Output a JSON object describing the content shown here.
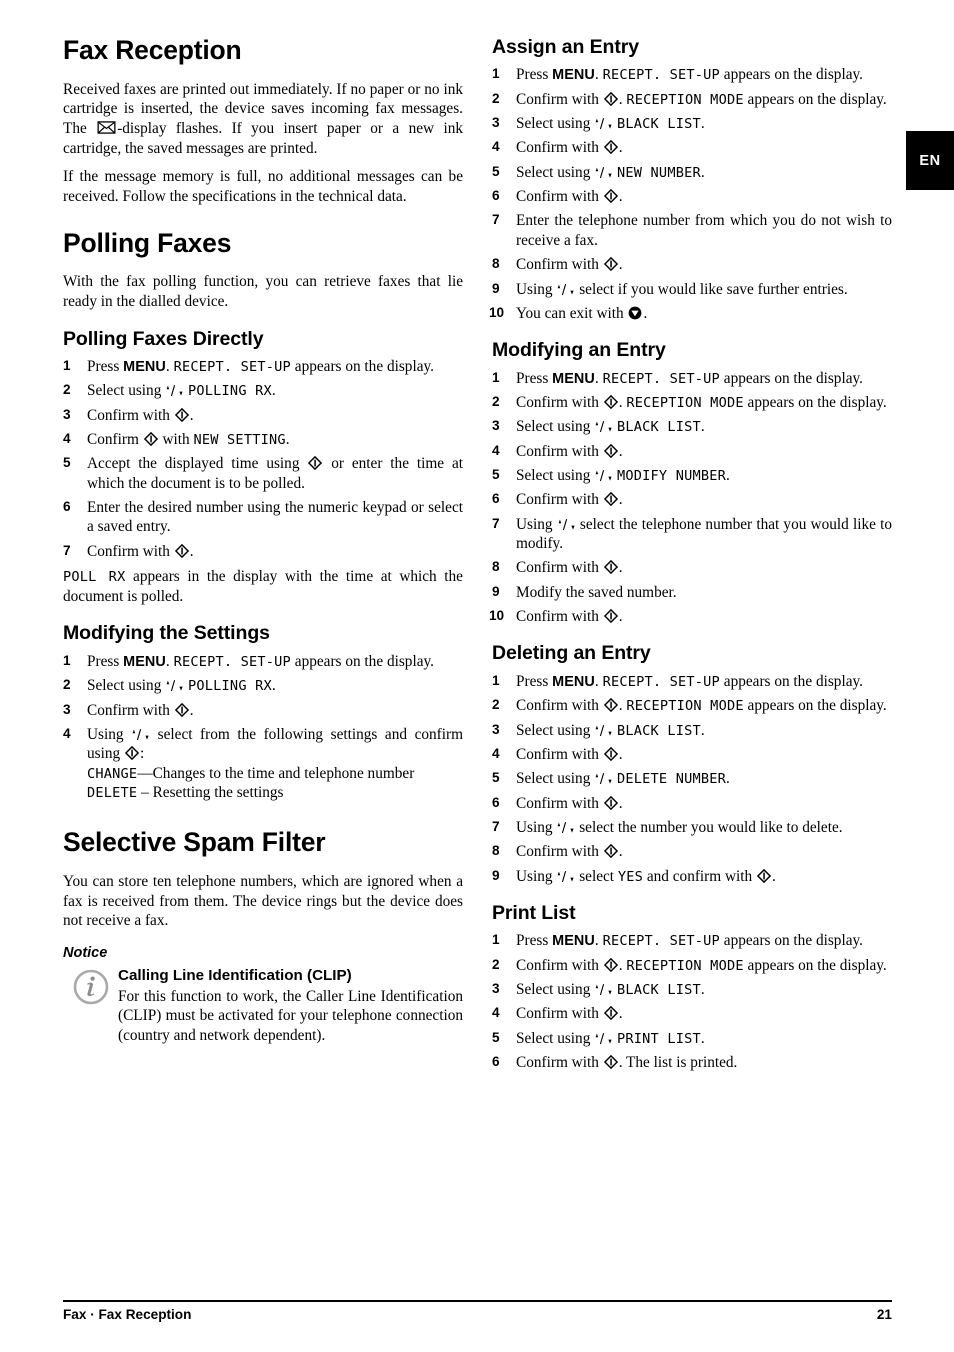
{
  "language_tab": "EN",
  "left_column": {
    "h1_fax_reception": "Fax Reception",
    "p_intro_1a": "Received faxes are printed out immediately. If no paper or no ink cartridge is inserted, the device saves incoming fax messages. The ",
    "p_intro_1b": "-display flashes. If you insert paper or a new ink cartridge, the saved messages are printed.",
    "p_intro_2": "If the message memory is full, no additional messages can be received. Follow the specifications in the technical data.",
    "h1_polling_faxes": "Polling Faxes",
    "p_polling_intro": "With the fax polling function, you can retrieve faxes that lie ready in the dialled device.",
    "h2_polling_directly": "Polling Faxes Directly",
    "polling_directly_steps": [
      {
        "num": "1",
        "pre": "Press ",
        "key": "MENU",
        "mid": ". ",
        "lcd": "RECEPT. SET-UP",
        "post": " appears on the display."
      },
      {
        "num": "2",
        "pre": "Select using ",
        "icon": "updown",
        "mid": " ",
        "lcd": "POLLING RX",
        "post": "."
      },
      {
        "num": "3",
        "pre": "Confirm with ",
        "icon": "ok",
        "post": "."
      },
      {
        "num": "4",
        "pre": "Confirm ",
        "lcd": "NEW SETTING",
        "mid": " with ",
        "icon": "ok",
        "post": "."
      },
      {
        "num": "5",
        "pre": "Accept the displayed time using ",
        "icon": "ok",
        "post": " or enter the time at which the document is to be polled."
      },
      {
        "num": "6",
        "pre": "Enter the desired number using the numeric keypad or select a saved entry."
      },
      {
        "num": "7",
        "pre": "Confirm with ",
        "icon": "ok",
        "post": "."
      }
    ],
    "p_poll_rx_lcd": "POLL RX",
    "p_poll_rx_text": " appears in the display with the time at which the document is polled.",
    "h2_modifying_settings": "Modifying the Settings",
    "modifying_settings_steps": [
      {
        "num": "1",
        "pre": "Press ",
        "key": "MENU",
        "mid": ". ",
        "lcd": "RECEPT. SET-UP",
        "post": " appears on the display."
      },
      {
        "num": "2",
        "pre": "Select using ",
        "icon": "updown",
        "mid": " ",
        "lcd": "POLLING RX",
        "post": "."
      },
      {
        "num": "3",
        "pre": "Confirm with ",
        "icon": "ok",
        "post": "."
      }
    ],
    "step4_pre": "Using ",
    "step4_mid": " select from the following settings and confirm using ",
    "step4_colon": ":",
    "step4_change_lcd": "CHANGE",
    "step4_change_text": "—Changes to the time and telephone number",
    "step4_delete_lcd": "DELETE",
    "step4_delete_text": " – Resetting the settings",
    "h1_spam_filter": "Selective Spam Filter",
    "p_spam_intro": "You can store ten telephone numbers, which are ignored when a fax is received from them. The device rings but the device does not receive a fax.",
    "h3_notice": "Notice",
    "notice_title": "Calling Line Identification (CLIP)",
    "notice_text": "For this function to work, the Caller Line Identification (CLIP) must be activated for your telephone connection (country and network dependent)."
  },
  "right_column": {
    "h2_assign_entry": "Assign an Entry",
    "assign_entry_steps": [
      {
        "num": "1",
        "pre": "Press ",
        "key": "MENU",
        "mid": ". ",
        "lcd": "RECEPT. SET-UP",
        "post": " appears on the display."
      },
      {
        "num": "2",
        "pre": "Confirm with ",
        "icon": "ok",
        "mid": ". ",
        "lcd": "RECEPTION MODE",
        "post": " appears on the display."
      },
      {
        "num": "3",
        "pre": "Select using ",
        "icon": "updown",
        "mid": " ",
        "lcd": "BLACK LIST",
        "post": "."
      },
      {
        "num": "4",
        "pre": "Confirm with ",
        "icon": "ok",
        "post": "."
      },
      {
        "num": "5",
        "pre": "Select using ",
        "icon": "updown",
        "mid": " ",
        "lcd": "NEW NUMBER",
        "post": "."
      },
      {
        "num": "6",
        "pre": "Confirm with ",
        "icon": "ok",
        "post": "."
      },
      {
        "num": "7",
        "pre": "Enter the telephone number from which you do not wish to receive a fax."
      },
      {
        "num": "8",
        "pre": "Confirm with ",
        "icon": "ok",
        "post": "."
      },
      {
        "num": "9",
        "pre": "Using ",
        "icon": "updown",
        "post": " select if you would like save further entries."
      },
      {
        "num": "10",
        "pre": "You can exit with ",
        "icon": "stop",
        "post": "."
      }
    ],
    "h2_modifying_entry": "Modifying an Entry",
    "modifying_entry_steps": [
      {
        "num": "1",
        "pre": "Press ",
        "key": "MENU",
        "mid": ". ",
        "lcd": "RECEPT. SET-UP",
        "post": " appears on the display."
      },
      {
        "num": "2",
        "pre": "Confirm with ",
        "icon": "ok",
        "mid": ". ",
        "lcd": "RECEPTION MODE",
        "post": " appears on the display."
      },
      {
        "num": "3",
        "pre": "Select using ",
        "icon": "updown",
        "mid": " ",
        "lcd": "BLACK LIST",
        "post": "."
      },
      {
        "num": "4",
        "pre": "Confirm with ",
        "icon": "ok",
        "post": "."
      },
      {
        "num": "5",
        "pre": "Select using ",
        "icon": "updown",
        "mid": " ",
        "lcd": "MODIFY NUMBER",
        "post": "."
      },
      {
        "num": "6",
        "pre": "Confirm with ",
        "icon": "ok",
        "post": "."
      },
      {
        "num": "7",
        "pre": "Using ",
        "icon": "updown",
        "post": " select the telephone number that you would like to modify."
      },
      {
        "num": "8",
        "pre": "Confirm with ",
        "icon": "ok",
        "post": "."
      },
      {
        "num": "9",
        "pre": "Modify the saved number."
      },
      {
        "num": "10",
        "pre": "Confirm with ",
        "icon": "ok",
        "post": "."
      }
    ],
    "h2_deleting_entry": "Deleting an Entry",
    "deleting_entry_steps": [
      {
        "num": "1",
        "pre": "Press ",
        "key": "MENU",
        "mid": ". ",
        "lcd": "RECEPT. SET-UP",
        "post": " appears on the display."
      },
      {
        "num": "2",
        "pre": "Confirm with ",
        "icon": "ok",
        "mid": ". ",
        "lcd": "RECEPTION MODE",
        "post": " appears on the display."
      },
      {
        "num": "3",
        "pre": "Select using ",
        "icon": "updown",
        "mid": " ",
        "lcd": "BLACK LIST",
        "post": "."
      },
      {
        "num": "4",
        "pre": "Confirm with ",
        "icon": "ok",
        "post": "."
      },
      {
        "num": "5",
        "pre": "Select using ",
        "icon": "updown",
        "mid": " ",
        "lcd": "DELETE NUMBER",
        "post": "."
      },
      {
        "num": "6",
        "pre": "Confirm with ",
        "icon": "ok",
        "post": "."
      },
      {
        "num": "7",
        "pre": "Using ",
        "icon": "updown",
        "post": " select the number you would like to delete."
      },
      {
        "num": "8",
        "pre": "Confirm with ",
        "icon": "ok",
        "post": "."
      },
      {
        "num": "9",
        "pre": "Using ",
        "icon": "updown",
        "mid": " select ",
        "lcd": "YES",
        "mid2": " and confirm with ",
        "icon2": "ok",
        "post": "."
      }
    ],
    "h2_print_list": "Print List",
    "print_list_steps": [
      {
        "num": "1",
        "pre": "Press ",
        "key": "MENU",
        "mid": ". ",
        "lcd": "RECEPT. SET-UP",
        "post": " appears on the display."
      },
      {
        "num": "2",
        "pre": "Confirm with ",
        "icon": "ok",
        "mid": ". ",
        "lcd": "RECEPTION MODE",
        "post": " appears on the display."
      },
      {
        "num": "3",
        "pre": "Select using ",
        "icon": "updown",
        "mid": " ",
        "lcd": "BLACK LIST",
        "post": "."
      },
      {
        "num": "4",
        "pre": "Confirm with ",
        "icon": "ok",
        "post": "."
      },
      {
        "num": "5",
        "pre": "Select using ",
        "icon": "updown",
        "mid": " ",
        "lcd": "PRINT LIST",
        "post": "."
      },
      {
        "num": "6",
        "pre": "Confirm with ",
        "icon": "ok",
        "mid": ". The list is printed."
      }
    ]
  },
  "footer": {
    "left": "Fax · Fax Reception",
    "page_number": "21"
  },
  "icons": {
    "ok": "ok-key-icon",
    "stop": "stop-key-icon",
    "updown": "up-down-arrow-icon",
    "envelope": "envelope-icon",
    "info": "info-icon"
  },
  "colors": {
    "text": "#000000",
    "tab_background": "#000000",
    "tab_text": "#ffffff",
    "info_icon_gray": "#a9a9a9"
  }
}
